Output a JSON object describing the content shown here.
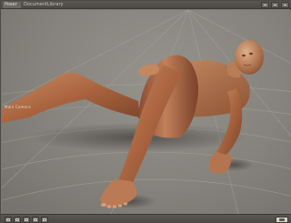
{
  "app": {
    "tabs": [
      {
        "label": "Poser"
      },
      {
        "label": "Document"
      },
      {
        "label": "Library"
      }
    ]
  },
  "viewport": {
    "camera_label": "Main Camera"
  },
  "icons": {
    "minimize": "minimize-icon",
    "maximize": "maximize-icon",
    "close": "close-icon",
    "render": "render-icon"
  },
  "colors": {
    "background": "#86837d",
    "skin": "#b06e4c",
    "grid": "#a6a29a"
  }
}
